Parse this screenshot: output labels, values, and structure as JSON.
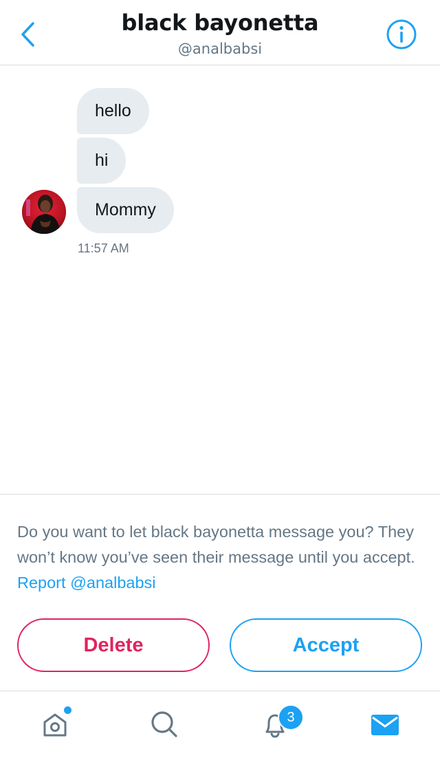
{
  "header": {
    "title": "black bayonetta",
    "handle": "@analbabsi",
    "back_icon": "chevron-left-icon",
    "info_icon": "info-icon"
  },
  "conversation": {
    "messages": [
      {
        "text": "hello"
      },
      {
        "text": "hi"
      },
      {
        "text": "Mommy"
      }
    ],
    "timestamp": "11:57 AM",
    "avatar_icon": "avatar"
  },
  "request": {
    "prompt": "Do you want to let black bayonetta message you? They won’t know you’ve seen their message until you accept.",
    "report_link": "Report @analbabsi",
    "delete_label": "Delete",
    "accept_label": "Accept"
  },
  "tabbar": {
    "items": [
      {
        "name": "home",
        "icon": "home-icon",
        "has_dot": true
      },
      {
        "name": "search",
        "icon": "search-icon"
      },
      {
        "name": "notifications",
        "icon": "bell-icon",
        "badge": "3"
      },
      {
        "name": "messages",
        "icon": "mail-icon",
        "active": true
      }
    ]
  },
  "colors": {
    "accent": "#1da1f2",
    "danger": "#e0245e",
    "bubble": "#e6ecf0",
    "muted_text": "#657786",
    "text": "#14171a"
  }
}
